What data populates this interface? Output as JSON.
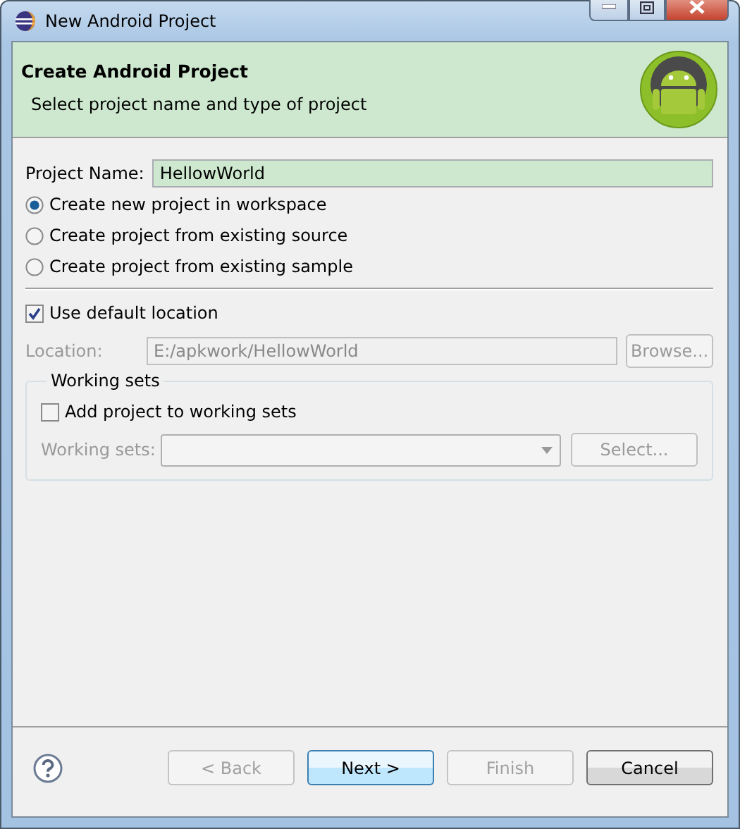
{
  "window": {
    "title": "New Android Project"
  },
  "header": {
    "title": "Create Android Project",
    "subtitle": "Select project name and type of project"
  },
  "project_name": {
    "label": "Project Name:",
    "value": "HellowWorld"
  },
  "options": [
    {
      "label": "Create new project in workspace",
      "selected": true
    },
    {
      "label": "Create project from existing source",
      "selected": false
    },
    {
      "label": "Create project from existing sample",
      "selected": false
    }
  ],
  "use_default_location": {
    "label": "Use default location",
    "checked": true
  },
  "location": {
    "label": "Location:",
    "value": "E:/apkwork/HellowWorld",
    "disabled": true,
    "browse": "Browse..."
  },
  "working_sets": {
    "title": "Working sets",
    "add": {
      "label": "Add project to working sets",
      "checked": false
    },
    "label": "Working sets:",
    "button": "Select...",
    "disabled": true
  },
  "buttons": [
    {
      "label": "< Back",
      "disabled": true,
      "default": false
    },
    {
      "label": "Next >",
      "disabled": false,
      "default": true
    },
    {
      "label": "Finish",
      "disabled": true,
      "default": false
    },
    {
      "label": "Cancel",
      "disabled": false,
      "default": false
    }
  ]
}
